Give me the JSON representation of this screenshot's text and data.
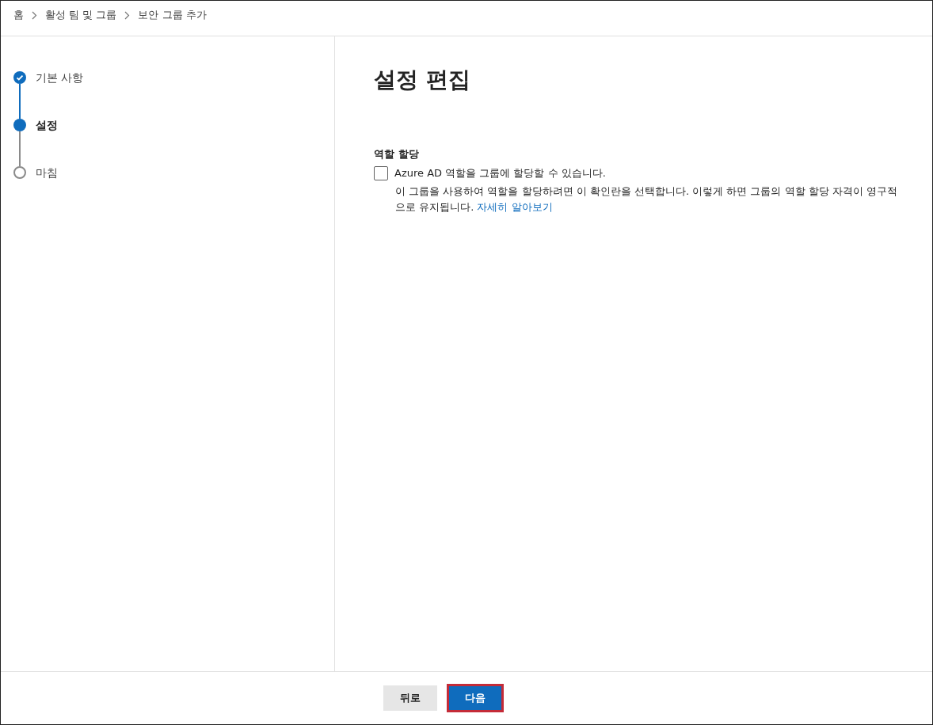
{
  "breadcrumb": [
    "홈",
    "활성 팀 및 그룹",
    "보안 그룹 추가"
  ],
  "steps": [
    {
      "label": "기본 사항",
      "completed": true,
      "selected": false
    },
    {
      "label": "설정",
      "completed": false,
      "selected": true
    },
    {
      "label": "마침",
      "completed": false,
      "selected": false
    }
  ],
  "heading": "설정 편집",
  "section": {
    "label": "역할 할당",
    "checkbox": {
      "label": "Azure AD 역할을 그룹에 할당할 수 있습니다.",
      "checked": false
    },
    "description": "이 그룹을 사용하여 역할을 할당하려면 이 확인란을 선택합니다. 이렇게 하면 그룹의 역할 할당 자격이 영구적으로 유지됩니다.",
    "link": "자세히 알아보기"
  },
  "buttons": [
    {
      "label": "뒤로",
      "kind": "secondary",
      "highlighted": false
    },
    {
      "label": "다음",
      "kind": "primary",
      "highlighted": true
    }
  ]
}
